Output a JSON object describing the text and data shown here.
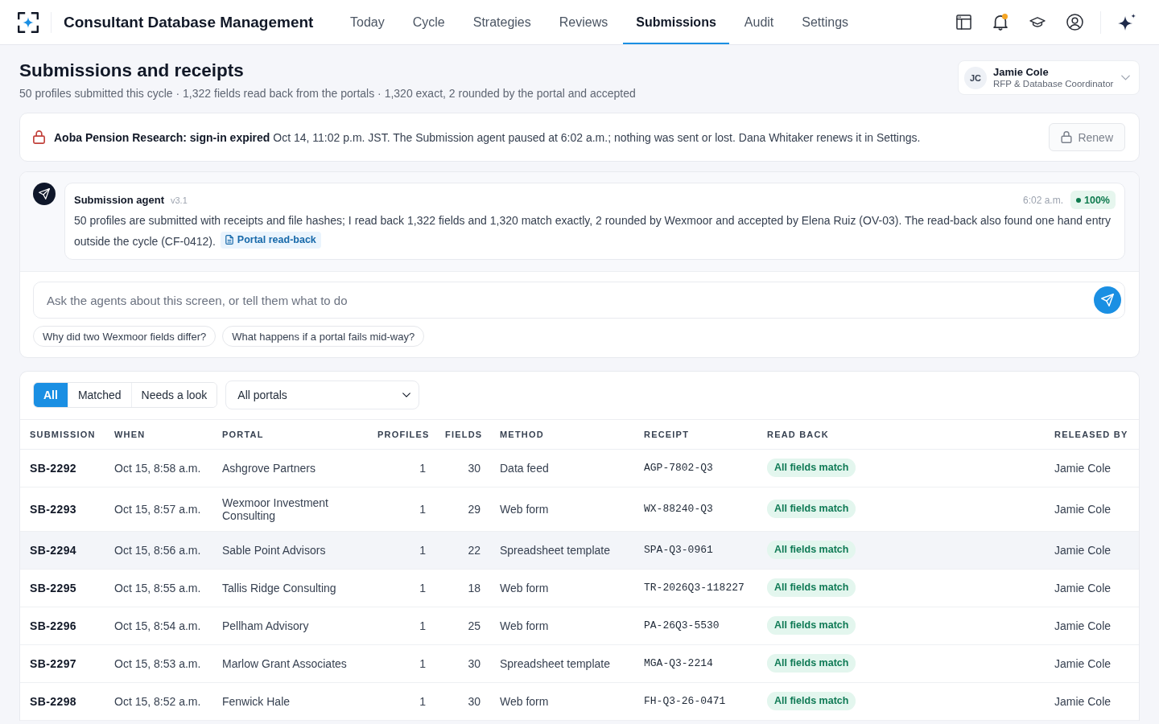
{
  "top_bar": {
    "app_title": "Consultant Database Management",
    "tabs": [
      {
        "label": "Today",
        "selected": false
      },
      {
        "label": "Cycle",
        "selected": false
      },
      {
        "label": "Strategies",
        "selected": false
      },
      {
        "label": "Reviews",
        "selected": false
      },
      {
        "label": "Submissions",
        "selected": true
      },
      {
        "label": "Audit",
        "selected": false
      },
      {
        "label": "Settings",
        "selected": false
      }
    ],
    "notifications_unread": true
  },
  "header": {
    "title": "Submissions and receipts",
    "subtitle": "50 profiles submitted this cycle · 1,322 fields read back from the portals · 1,320 exact, 2 rounded by the portal and accepted",
    "user": {
      "initials": "JC",
      "name": "Jamie Cole",
      "role": "RFP & Database Coordinator"
    }
  },
  "alert": {
    "message": "**Aoba Pension Research: sign-in expired** Oct 14, 11:02 p.m. JST. The Submission agent paused at 6:02 a.m.; nothing was sent or lost. Dana Whitaker renews it in Settings.",
    "action": {
      "label": "Renew",
      "disabled": true
    }
  },
  "agent": {
    "name": "Submission agent",
    "version": "v3.1",
    "time": "6:02 a.m.",
    "confidence": "100%",
    "message": "50 profiles are submitted with receipts and file hashes; I read back 1,322 fields and 1,320 match exactly, 2 rounded by Wexmoor and accepted by Elena Ruiz (OV-03). The read-back also found one hand entry outside the cycle (CF-0412).",
    "link": "Portal read-back",
    "input": {
      "placeholder": "Ask the agents about this screen, or tell them what to do"
    },
    "suggestions": [
      "Why did two Wexmoor fields differ?",
      "What happens if a portal fails mid-way?"
    ]
  },
  "table": {
    "filters": [
      {
        "label": "All",
        "selected": true
      },
      {
        "label": "Matched",
        "selected": false
      },
      {
        "label": "Needs a look",
        "selected": false
      }
    ],
    "portal_filter": "All portals",
    "columns": [
      "SUBMISSION",
      "WHEN",
      "PORTAL",
      "PROFILES",
      "FIELDS",
      "METHOD",
      "RECEIPT",
      "READ BACK",
      "RELEASED BY"
    ],
    "rows": [
      {
        "submission": "SB-2292",
        "when": "Oct 15, 8:58 a.m.",
        "portal": "Ashgrove Partners",
        "profiles": "1",
        "fields": "30",
        "method": "Data feed",
        "receipt": "AGP-7802-Q3",
        "read_back": "All fields match",
        "released_by": "Jamie Cole",
        "highlighted": false
      },
      {
        "submission": "SB-2293",
        "when": "Oct 15, 8:57 a.m.",
        "portal": "Wexmoor Investment Consulting",
        "profiles": "1",
        "fields": "29",
        "method": "Web form",
        "receipt": "WX-88240-Q3",
        "read_back": "All fields match",
        "released_by": "Jamie Cole",
        "highlighted": false
      },
      {
        "submission": "SB-2294",
        "when": "Oct 15, 8:56 a.m.",
        "portal": "Sable Point Advisors",
        "profiles": "1",
        "fields": "22",
        "method": "Spreadsheet template",
        "receipt": "SPA-Q3-0961",
        "read_back": "All fields match",
        "released_by": "Jamie Cole",
        "highlighted": true
      },
      {
        "submission": "SB-2295",
        "when": "Oct 15, 8:55 a.m.",
        "portal": "Tallis Ridge Consulting",
        "profiles": "1",
        "fields": "18",
        "method": "Web form",
        "receipt": "TR-2026Q3-118227",
        "read_back": "All fields match",
        "released_by": "Jamie Cole",
        "highlighted": false
      },
      {
        "submission": "SB-2296",
        "when": "Oct 15, 8:54 a.m.",
        "portal": "Pellham Advisory",
        "profiles": "1",
        "fields": "25",
        "method": "Web form",
        "receipt": "PA-26Q3-5530",
        "read_back": "All fields match",
        "released_by": "Jamie Cole",
        "highlighted": false
      },
      {
        "submission": "SB-2297",
        "when": "Oct 15, 8:53 a.m.",
        "portal": "Marlow Grant Associates",
        "profiles": "1",
        "fields": "30",
        "method": "Spreadsheet template",
        "receipt": "MGA-Q3-2214",
        "read_back": "All fields match",
        "released_by": "Jamie Cole",
        "highlighted": false
      },
      {
        "submission": "SB-2298",
        "when": "Oct 15, 8:52 a.m.",
        "portal": "Fenwick Hale",
        "profiles": "1",
        "fields": "30",
        "method": "Web form",
        "receipt": "FH-Q3-26-0471",
        "read_back": "All fields match",
        "released_by": "Jamie Cole",
        "highlighted": false
      }
    ]
  }
}
